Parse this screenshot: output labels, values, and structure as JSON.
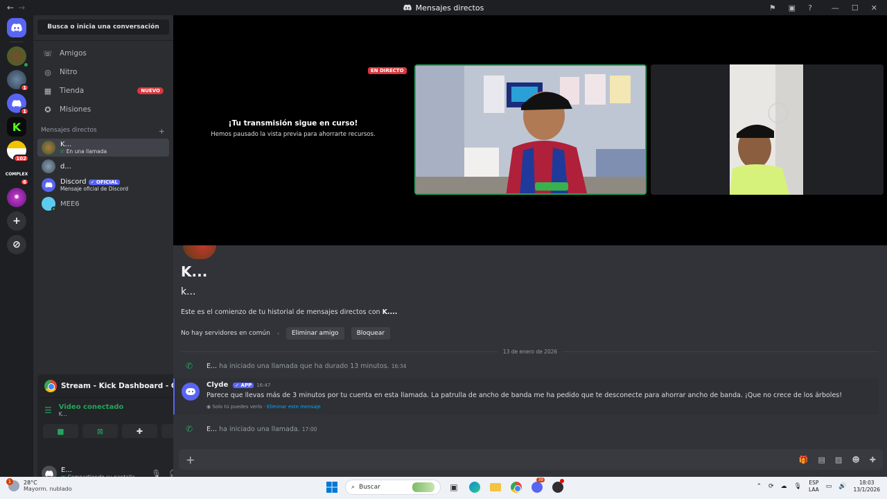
{
  "window": {
    "title": "Mensajes directos",
    "back_icon": "arrow-left-icon",
    "forward_icon": "arrow-right-icon"
  },
  "servers": [
    {
      "name": "discord-home",
      "badge": ""
    },
    {
      "name": "server-1",
      "badge": ""
    },
    {
      "name": "server-2",
      "badge": "1"
    },
    {
      "name": "server-3",
      "badge": "1"
    },
    {
      "name": "server-4",
      "badge": ""
    },
    {
      "name": "server-5",
      "badge": "102"
    },
    {
      "name": "server-6",
      "badge": "6"
    },
    {
      "name": "server-7",
      "badge": ""
    }
  ],
  "sidebar": {
    "search_label": "Busca o inicia una conversación",
    "nav": [
      {
        "label": "Amigos"
      },
      {
        "label": "Nitro"
      },
      {
        "label": "Tienda",
        "badge": "NUEVO"
      },
      {
        "label": "Misiones"
      }
    ],
    "dm_header": "Mensajes directos",
    "dm_add": "+",
    "dms": [
      {
        "name": "K...",
        "sub": "En una llamada"
      },
      {
        "name": "d...",
        "sub": ""
      },
      {
        "name": "Discord",
        "tag": "✓ OFICIAL",
        "sub": "Mensaje oficial de Discord"
      },
      {
        "name": "MEE6",
        "sub": ""
      }
    ]
  },
  "voice_panel": {
    "stream_title": "Stream - Kick Dashboard - Google ...",
    "status": "Video conectado",
    "channel": "K..."
  },
  "user_panel": {
    "name": "E...",
    "status": "Compartiendo su pantalla"
  },
  "stream": {
    "paused_title": "¡Tu transmisión sigue en curso!",
    "paused_sub": "Hemos pausado la vista previa para ahorrarte recursos.",
    "live_badge": "EN DIRECTO"
  },
  "chat": {
    "display_name": "K...",
    "username": "k...",
    "intro_prefix": "Este es el comienzo de tu historial de mensajes directos con ",
    "intro_name": "K....",
    "mutual": "No hay servidores en común",
    "remove_friend": "Eliminar amigo",
    "block": "Bloquear",
    "date_divider": "13 de enero de 2026",
    "messages": [
      {
        "author": "E...",
        "text": "ha iniciado una llamada que ha durado 13 minutos.",
        "time": "16:34"
      },
      {
        "author": "E...",
        "text": "ha iniciado una llamada.",
        "time": "17:00"
      }
    ],
    "clyde": {
      "author": "Clyde",
      "tag": "✓ APP",
      "time": "16:47",
      "text": "Parece que llevas más de 3 minutos por tu cuenta en esta llamada. La patrulla de ancho de banda me ha pedido que te desconecte para ahorrar ancho de banda. ¡Que no crece de los árboles!",
      "ephemeral": "Solo tú puedes verlo · ",
      "dismiss": "Eliminar este mensaje"
    }
  },
  "taskbar": {
    "weather_temp": "28°C",
    "weather_desc": "Mayorm. nublado",
    "weather_badge": "1",
    "search": "Buscar",
    "lang1": "ESP",
    "lang2": "LAA",
    "time": "18:03",
    "date": "13/1/2026",
    "discord_badge": "39"
  },
  "colors": {
    "accent": "#5865f2",
    "green": "#23a55a",
    "red": "#da373c"
  }
}
